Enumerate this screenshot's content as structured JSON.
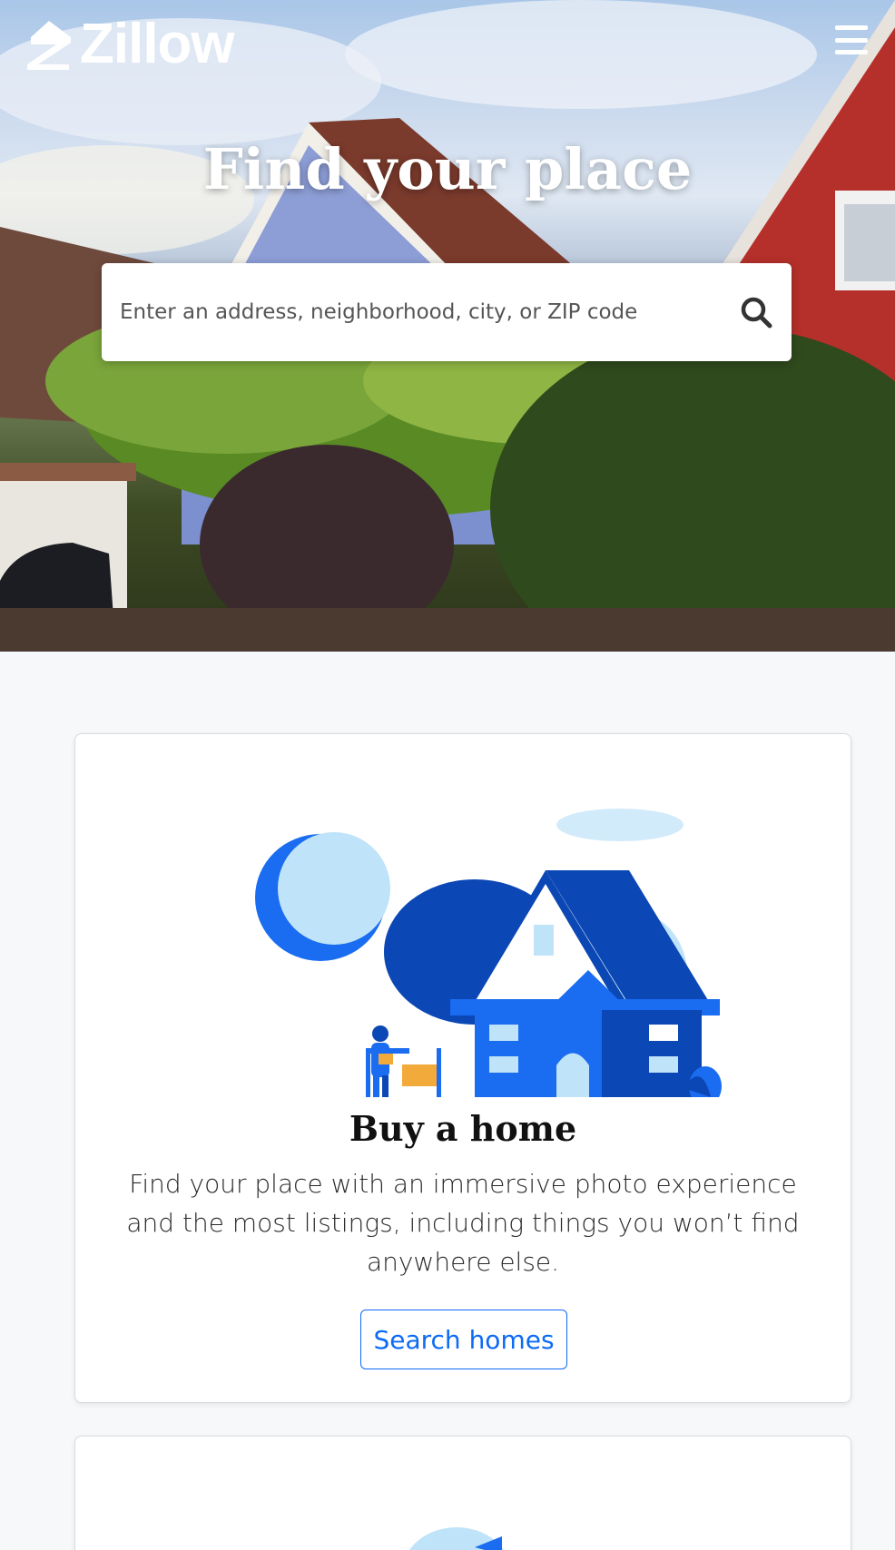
{
  "header": {
    "brand": "Zillow",
    "menu_icon": "hamburger-menu-icon"
  },
  "hero": {
    "title": "Find your place",
    "search": {
      "placeholder": "Enter an address, neighborhood, city, or ZIP code",
      "value": "",
      "icon": "search-icon"
    }
  },
  "cards": [
    {
      "title": "Buy a home",
      "description": "Find your place with an immersive photo experience and the most listings, including things you won’t find anywhere else.",
      "button_label": "Search homes",
      "illustration": "house-with-agent-illustration"
    }
  ],
  "colors": {
    "accent": "#0d6af6",
    "house_dark": "#0b47b5",
    "house_mid": "#1a6cf0",
    "light_blue": "#bfe3f8",
    "sign_yellow": "#f2aa3a"
  }
}
